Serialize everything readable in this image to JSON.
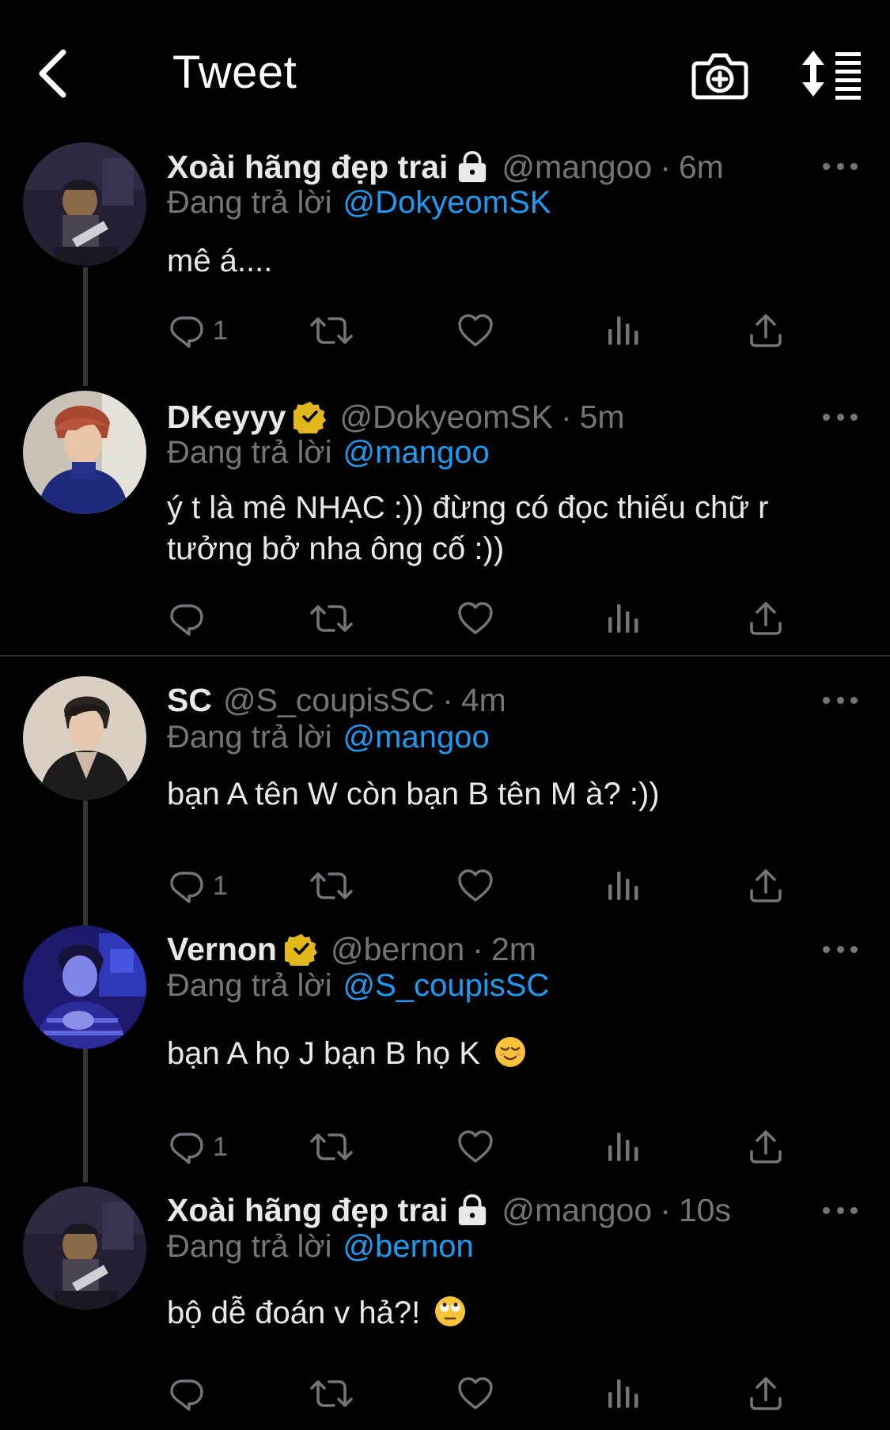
{
  "header": {
    "title": "Tweet",
    "back_icon": "chevron-left-icon",
    "camera_icon": "camera-plus-icon",
    "sort_icon": "sort-list-icon"
  },
  "colors": {
    "background": "#000000",
    "text_primary": "#e7e9ea",
    "text_secondary": "#71767b",
    "link_blue": "#1d9bf0",
    "verified_gold": "#e2b719"
  },
  "tweets": [
    {
      "name": "Xoài hãng đẹp trai",
      "badge": "lock-icon",
      "handle": "@mangoo",
      "dot": "·",
      "time": "6m",
      "replying_label": "Đang trả lời",
      "replying_to": "@DokyeomSK",
      "text": "mê á....",
      "reply_count": "1",
      "retweet_count": "",
      "like_count": ""
    },
    {
      "name": "DKeyyy",
      "badge": "verified-gold-icon",
      "handle": "@DokyeomSK",
      "dot": "·",
      "time": "5m",
      "replying_label": "Đang trả lời",
      "replying_to": "@mangoo",
      "text": "ý t là mê NHẠC :)) đừng có đọc thiếu chữ r tưởng bở nha ông cố :))",
      "reply_count": "",
      "retweet_count": "",
      "like_count": ""
    },
    {
      "name": "SC",
      "badge": "",
      "handle": "@S_coupisSC",
      "dot": "·",
      "time": "4m",
      "replying_label": "Đang trả lời",
      "replying_to": "@mangoo",
      "text": "bạn A tên W còn bạn B tên M à? :))",
      "reply_count": "1",
      "retweet_count": "",
      "like_count": ""
    },
    {
      "name": "Vernon",
      "badge": "verified-gold-icon",
      "handle": "@bernon",
      "dot": "·",
      "time": "2m",
      "replying_label": "Đang trả lời",
      "replying_to": "@S_coupisSC",
      "text": "bạn A họ J bạn B họ K",
      "emoji": "relieved-face-emoji",
      "reply_count": "1",
      "retweet_count": "",
      "like_count": ""
    },
    {
      "name": "Xoài hãng đẹp trai",
      "badge": "lock-icon",
      "handle": "@mangoo",
      "dot": "·",
      "time": "10s",
      "replying_label": "Đang trả lời",
      "replying_to": "@bernon",
      "text": "bộ dễ đoán v hả?!",
      "emoji": "eye-roll-face-emoji",
      "reply_count": "",
      "retweet_count": "",
      "like_count": ""
    }
  ]
}
